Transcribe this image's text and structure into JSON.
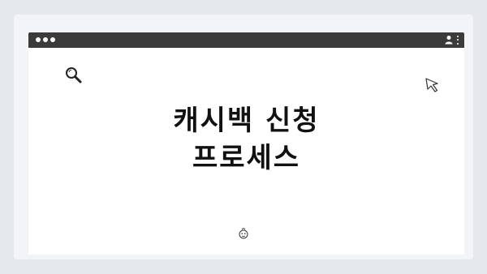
{
  "colors": {
    "page_bg": "#e5e9ee",
    "window_bg": "#f2f4f7",
    "titlebar": "#3b3b3b",
    "content_bg": "#ffffff",
    "text": "#111111"
  },
  "icons": {
    "search": "search-icon",
    "cursor": "cursor-icon",
    "user": "user-icon",
    "menu": "kebab-menu-icon",
    "face": "face-icon"
  },
  "main": {
    "headline_line1": "캐시백 신청",
    "headline_line2": "프로세스"
  }
}
